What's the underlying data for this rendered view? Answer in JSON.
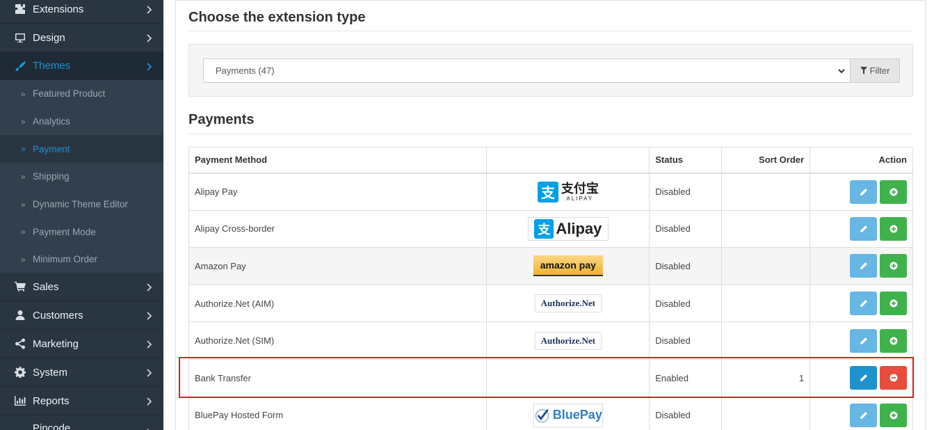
{
  "sidebar": {
    "items": [
      {
        "label": "Extensions",
        "icon": "puzzle-icon"
      },
      {
        "label": "Design",
        "icon": "monitor-icon"
      },
      {
        "label": "Themes",
        "icon": "brush-icon",
        "active": true
      },
      {
        "label": "Sales",
        "icon": "cart-icon"
      },
      {
        "label": "Customers",
        "icon": "user-icon"
      },
      {
        "label": "Marketing",
        "icon": "share-icon"
      },
      {
        "label": "System",
        "icon": "gear-icon"
      },
      {
        "label": "Reports",
        "icon": "bar-chart-icon"
      },
      {
        "label": "Pincode",
        "icon": ""
      }
    ],
    "submenu": [
      {
        "label": "Featured Product"
      },
      {
        "label": "Analytics"
      },
      {
        "label": "Payment",
        "active": true
      },
      {
        "label": "Shipping"
      },
      {
        "label": "Dynamic Theme Editor"
      },
      {
        "label": "Payment Mode"
      },
      {
        "label": "Minimum Order"
      }
    ],
    "submenu_bullet": "»"
  },
  "main": {
    "type_heading": "Choose the extension type",
    "select_value": "Payments (47)",
    "filter_label": "Filter",
    "section_heading": "Payments",
    "table": {
      "headers": [
        "Payment Method",
        "",
        "Status",
        "Sort Order",
        "Action"
      ],
      "rows": [
        {
          "name": "Alipay Pay",
          "logo": "alipay-cn",
          "status": "Disabled",
          "sort": "",
          "installed": false
        },
        {
          "name": "Alipay Cross-border",
          "logo": "alipay-en",
          "status": "Disabled",
          "sort": "",
          "installed": false
        },
        {
          "name": "Amazon Pay",
          "logo": "amazon",
          "status": "Disabled",
          "sort": "",
          "installed": false
        },
        {
          "name": "Authorize.Net (AIM)",
          "logo": "authnet",
          "status": "Disabled",
          "sort": "",
          "installed": false
        },
        {
          "name": "Authorize.Net (SIM)",
          "logo": "authnet",
          "status": "Disabled",
          "sort": "",
          "installed": false
        },
        {
          "name": "Bank Transfer",
          "logo": "",
          "status": "Enabled",
          "sort": "1",
          "installed": true
        },
        {
          "name": "BluePay Hosted Form",
          "logo": "bluepay",
          "status": "Disabled",
          "sort": "",
          "installed": false
        }
      ]
    },
    "logos": {
      "alipay_mark": "支",
      "alipay_cn_big": "支付宝",
      "alipay_cn_small": "ALIPAY",
      "alipay_en_word": "Alipay",
      "amazon_word": "amazon pay",
      "authnet_word": "Authorize.Net",
      "bluepay_word": "BluePay"
    }
  },
  "colors": {
    "sidebar_bg": "#2a3542",
    "accent": "#1e91cf",
    "success": "#3fb24c",
    "danger": "#e74c3c",
    "highlight": "#e01b1b"
  }
}
